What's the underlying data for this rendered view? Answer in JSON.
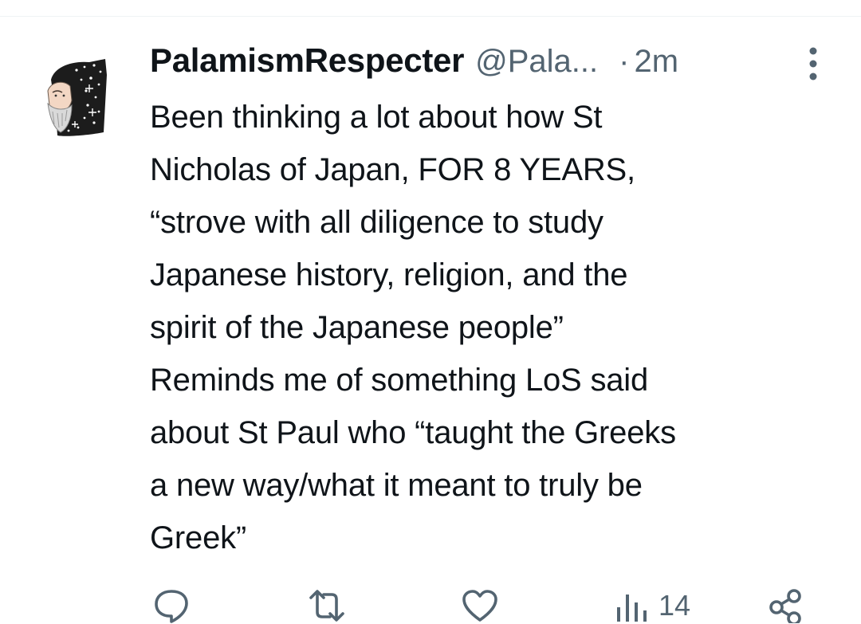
{
  "tweet": {
    "author": {
      "display_name": "PalamismRespecter",
      "handle": "@Pala...",
      "avatar_icon": "byzantine-icon-avatar"
    },
    "separator": "·",
    "timestamp": "2m",
    "text": "Been thinking a lot about how St\nNicholas of Japan, FOR 8 YEARS,\n“strove with all diligence to study\nJapanese history, religion, and the\nspirit of the Japanese people”\nReminds me of something LoS said\nabout St Paul who “taught the Greeks\na new way/what it meant to truly be\nGreek”",
    "actions": {
      "reply_icon": "speech-bubble-icon",
      "retweet_icon": "repost-arrows-icon",
      "like_icon": "heart-icon",
      "views_icon": "bar-chart-icon",
      "views_count": "14",
      "share_icon": "share-nodes-icon"
    }
  },
  "colors": {
    "text_primary": "#0f1419",
    "text_secondary": "#536471",
    "divider": "#eff3f4"
  }
}
